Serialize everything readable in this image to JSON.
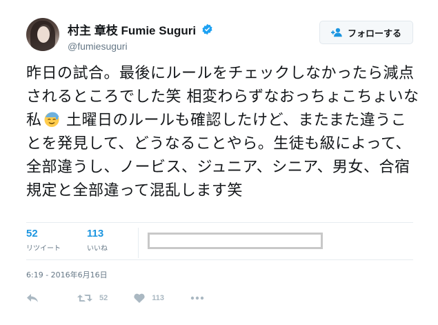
{
  "user": {
    "display_name": "村主 章枝 Fumie Suguri",
    "handle": "@fumiesuguri",
    "verified_icon": "verified-badge-icon"
  },
  "follow_button": {
    "label": "フォローする",
    "icon": "follow-person-plus-icon"
  },
  "tweet": {
    "text_before_emoji": "昨日の試合。最後にルールをチェックしなかったら減点されるところでした笑 相変わらずなおっちょこちょいな私",
    "emoji": "sweat-smile-emoji",
    "text_after_emoji": " 土曜日のルールも確認したけど、またまた違うことを発見して、どうなることやら。生徒も級によって、全部違うし、ノービス、ジュニア、シニア、男女、合宿規定と全部違って混乱します笑"
  },
  "stats": {
    "retweets": {
      "value": "52",
      "label": "リツイート"
    },
    "likes": {
      "value": "113",
      "label": "いいね"
    }
  },
  "timestamp": "6:19 - 2016年6月16日",
  "actions": {
    "reply_icon": "reply-icon",
    "retweet_icon": "retweet-icon",
    "retweet_count": "52",
    "like_icon": "heart-icon",
    "like_count": "113",
    "more_icon": "more-dots-icon"
  },
  "colors": {
    "accent": "#1b95e0",
    "muted": "#657786",
    "icon_gray": "#aab8c2",
    "divider": "#e6ecf0"
  }
}
